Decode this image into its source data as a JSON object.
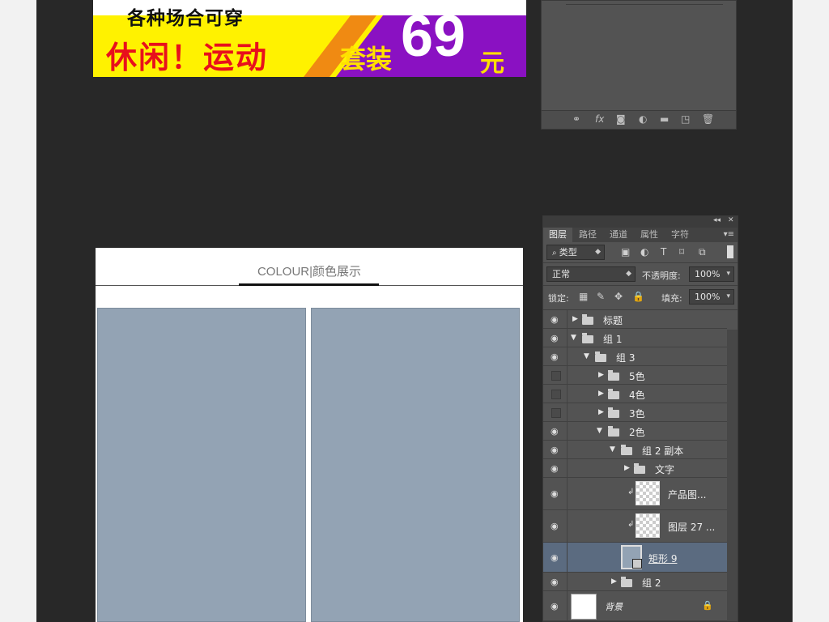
{
  "banner": {
    "subtitle": "各种场合可穿",
    "headline": "休闲！运动",
    "suit_label": "套装",
    "price": "69",
    "currency": "元",
    "colors": {
      "yellow": "#fff200",
      "orange": "#f08a12",
      "purple": "#8a11c2",
      "headline": "#e8101c"
    }
  },
  "colour_section": {
    "heading": "COLOUR|颜色展示",
    "swatch_color": "#93a3b4"
  },
  "top_panel": {
    "footer_icons": [
      "link-icon",
      "fx-icon",
      "mask-icon",
      "adjustment-icon",
      "folder-icon",
      "new-layer-icon",
      "trash-icon"
    ],
    "fx_label": "fx"
  },
  "layers_panel": {
    "collapse_glyph": "◂◂",
    "close_glyph": "✕",
    "tabs": [
      {
        "label": "图层",
        "active": true
      },
      {
        "label": "路径",
        "active": false
      },
      {
        "label": "通道",
        "active": false
      },
      {
        "label": "属性",
        "active": false
      },
      {
        "label": "字符",
        "active": false
      }
    ],
    "filter": {
      "value": "类型"
    },
    "blend_mode": "正常",
    "opacity_label": "不透明度:",
    "opacity_value": "100%",
    "lock_label": "锁定:",
    "fill_label": "填充:",
    "fill_value": "100%",
    "layers": [
      {
        "name": "标题",
        "visible": true
      },
      {
        "name": "组 1",
        "visible": true
      },
      {
        "name": "组 3",
        "visible": true
      },
      {
        "name": "5色",
        "visible": false
      },
      {
        "name": "4色",
        "visible": false
      },
      {
        "name": "3色",
        "visible": false
      },
      {
        "name": "2色",
        "visible": true
      },
      {
        "name": "组 2 副本",
        "visible": true
      },
      {
        "name": "文字",
        "visible": true
      },
      {
        "name": "产品图...",
        "visible": true
      },
      {
        "name": "图层 27 ...",
        "visible": true
      },
      {
        "name": "矩形 9",
        "visible": true,
        "selected": true
      },
      {
        "name": "组 2",
        "visible": true
      },
      {
        "name": "背景",
        "visible": true
      }
    ],
    "selected_color": "#5b6b80"
  }
}
